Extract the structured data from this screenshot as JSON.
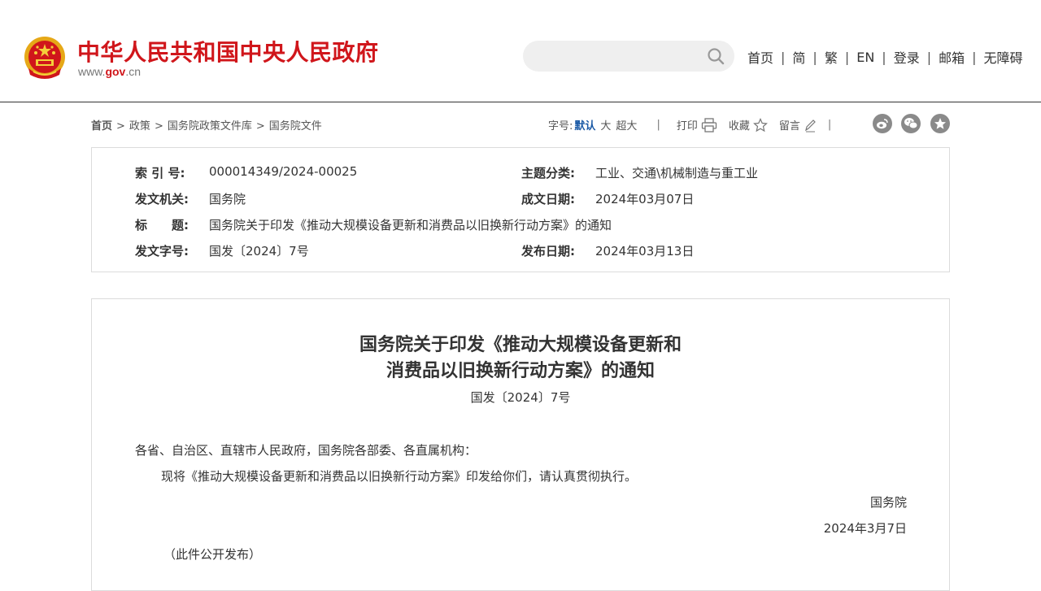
{
  "header": {
    "site_title": "中华人民共和国中央人民政府",
    "domain_prefix": "www.",
    "domain_main": "gov",
    "domain_suffix": ".cn",
    "search_placeholder": "",
    "nav": [
      "首页",
      "简",
      "繁",
      "EN",
      "登录",
      "邮箱",
      "无障碍"
    ],
    "nav_separator": "|"
  },
  "breadcrumb": {
    "items": [
      "首页",
      "政策",
      "国务院政策文件库",
      "国务院文件"
    ],
    "separator": ">"
  },
  "tools": {
    "font_size_label": "字号:",
    "font_sizes": [
      "默认",
      "大",
      "超大"
    ],
    "divider": "|",
    "print_label": "打印",
    "favorite_label": "收藏",
    "comment_label": "留言",
    "share": [
      "weibo-icon",
      "wechat-icon",
      "qzone-icon"
    ]
  },
  "meta": {
    "index_label": "索 引 号:",
    "index_value": "000014349/2024-00025",
    "topic_label": "主题分类:",
    "topic_value": "工业、交通\\机械制造与重工业",
    "issuer_label": "发文机关:",
    "issuer_value": "国务院",
    "written_date_label": "成文日期:",
    "written_date_value": "2024年03月07日",
    "title_label": "标　　题:",
    "title_value": "国务院关于印发《推动大规模设备更新和消费品以旧换新行动方案》的通知",
    "doc_no_label": "发文字号:",
    "doc_no_value": "国发〔2024〕7号",
    "publish_date_label": "发布日期:",
    "publish_date_value": "2024年03月13日"
  },
  "document": {
    "title_line1": "国务院关于印发《推动大规模设备更新和",
    "title_line2": "消费品以旧换新行动方案》的通知",
    "doc_number": "国发〔2024〕7号",
    "salutation": "各省、自治区、直辖市人民政府，国务院各部委、各直属机构：",
    "body": "现将《推动大规模设备更新和消费品以旧换新行动方案》印发给你们，请认真贯彻执行。",
    "signer": "国务院",
    "date": "2024年3月7日",
    "note": "（此件公开发布）"
  },
  "colors": {
    "brand_red": "#d0161b",
    "active_blue": "#1b5aa6",
    "share_gray": "#8a8a8a"
  }
}
